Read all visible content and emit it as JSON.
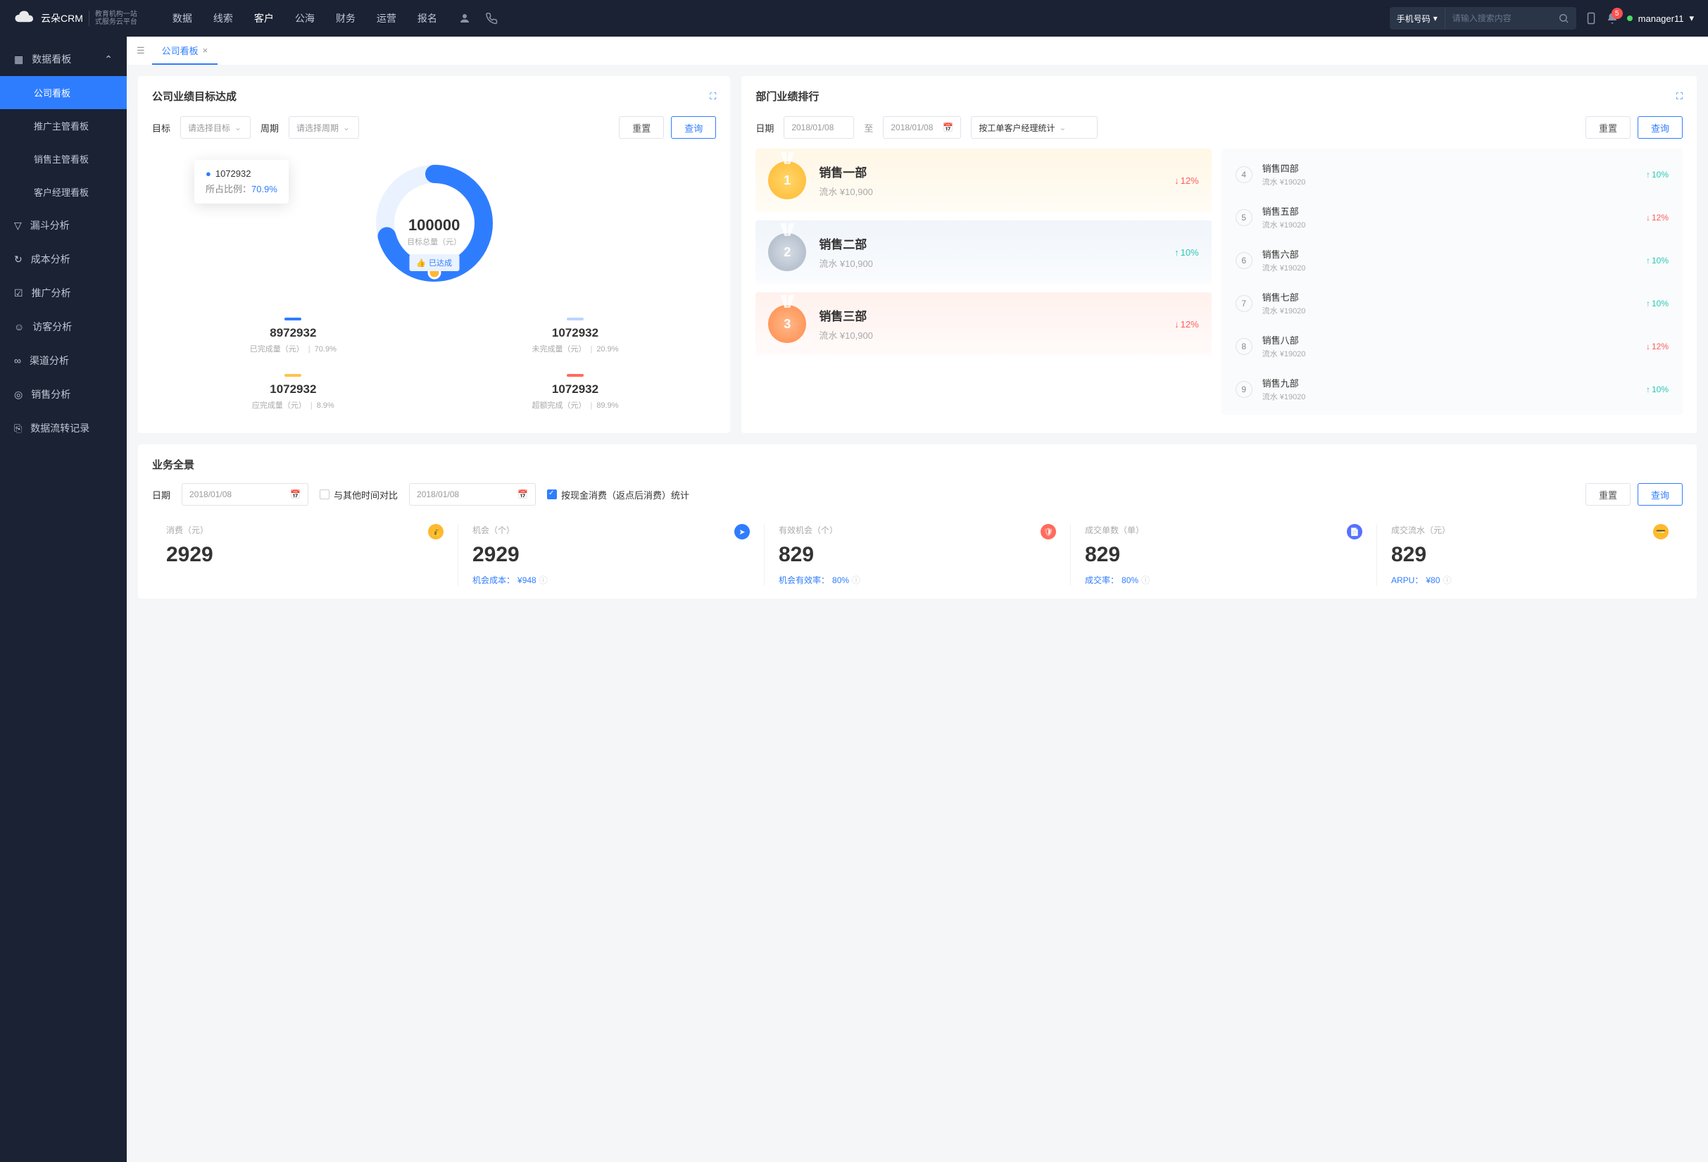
{
  "topbar": {
    "brand": "云朵CRM",
    "brand_sub": "教育机构一站\n式服务云平台",
    "nav": [
      "数据",
      "线索",
      "客户",
      "公海",
      "财务",
      "运营",
      "报名"
    ],
    "nav_active": 2,
    "search_type": "手机号码",
    "search_placeholder": "请输入搜索内容",
    "notif_count": "5",
    "user": "manager11"
  },
  "sidebar": {
    "items": [
      {
        "label": "数据看板",
        "expanded": true,
        "icon": "dashboard"
      },
      {
        "label": "公司看板",
        "sub": true,
        "active": true
      },
      {
        "label": "推广主管看板",
        "sub": true
      },
      {
        "label": "销售主管看板",
        "sub": true
      },
      {
        "label": "客户经理看板",
        "sub": true
      },
      {
        "label": "漏斗分析",
        "icon": "funnel"
      },
      {
        "label": "成本分析",
        "icon": "cost"
      },
      {
        "label": "推广分析",
        "icon": "promo"
      },
      {
        "label": "访客分析",
        "icon": "visitor"
      },
      {
        "label": "渠道分析",
        "icon": "channel"
      },
      {
        "label": "销售分析",
        "icon": "sales"
      },
      {
        "label": "数据流转记录",
        "icon": "flow"
      }
    ]
  },
  "tab": {
    "label": "公司看板"
  },
  "target_card": {
    "title": "公司业绩目标达成",
    "target_label": "目标",
    "target_placeholder": "请选择目标",
    "period_label": "周期",
    "period_placeholder": "请选择周期",
    "reset": "重置",
    "query": "查询",
    "tooltip_value": "1072932",
    "tooltip_ratio_label": "所占比例：",
    "tooltip_ratio": "70.9%",
    "donut_total": "100000",
    "donut_total_label": "目标总量（元）",
    "donut_badge": "已达成",
    "metrics": [
      {
        "color": "#2f7dff",
        "value": "8972932",
        "label": "已完成量（元）",
        "pct": "70.9%"
      },
      {
        "color": "#b9d6ff",
        "value": "1072932",
        "label": "未完成量（元）",
        "pct": "20.9%"
      },
      {
        "color": "#ffc34a",
        "value": "1072932",
        "label": "应完成量（元）",
        "pct": "8.9%"
      },
      {
        "color": "#ff6b5c",
        "value": "1072932",
        "label": "超额完成（元）",
        "pct": "89.9%"
      }
    ]
  },
  "rank_card": {
    "title": "部门业绩排行",
    "date_label": "日期",
    "date_from": "2018/01/08",
    "date_sep": "至",
    "date_to": "2018/01/08",
    "stat_by": "按工单客户经理统计",
    "reset": "重置",
    "query": "查询",
    "top3": [
      {
        "medal": "gold",
        "rank": "1",
        "name": "销售一部",
        "sub": "流水 ¥10,900",
        "change": "12%",
        "dir": "down"
      },
      {
        "medal": "silver",
        "rank": "2",
        "name": "销售二部",
        "sub": "流水 ¥10,900",
        "change": "10%",
        "dir": "up"
      },
      {
        "medal": "bronze",
        "rank": "3",
        "name": "销售三部",
        "sub": "流水 ¥10,900",
        "change": "12%",
        "dir": "down"
      }
    ],
    "rest": [
      {
        "rank": "4",
        "name": "销售四部",
        "sub": "流水 ¥19020",
        "change": "10%",
        "dir": "up"
      },
      {
        "rank": "5",
        "name": "销售五部",
        "sub": "流水 ¥19020",
        "change": "12%",
        "dir": "down"
      },
      {
        "rank": "6",
        "name": "销售六部",
        "sub": "流水 ¥19020",
        "change": "10%",
        "dir": "up"
      },
      {
        "rank": "7",
        "name": "销售七部",
        "sub": "流水 ¥19020",
        "change": "10%",
        "dir": "up"
      },
      {
        "rank": "8",
        "name": "销售八部",
        "sub": "流水 ¥19020",
        "change": "12%",
        "dir": "down"
      },
      {
        "rank": "9",
        "name": "销售九部",
        "sub": "流水 ¥19020",
        "change": "10%",
        "dir": "up"
      }
    ]
  },
  "overview": {
    "title": "业务全景",
    "date_label": "日期",
    "date1": "2018/01/08",
    "compare_label": "与其他时间对比",
    "date2": "2018/01/08",
    "cash_label": "按现金消费（返点后消费）统计",
    "reset": "重置",
    "query": "查询",
    "stats": [
      {
        "label": "消费（元）",
        "value": "2929",
        "icon_color": "#ffb830",
        "icon": "money",
        "sub": null
      },
      {
        "label": "机会（个）",
        "value": "2929",
        "icon_color": "#2f7dff",
        "icon": "send",
        "sub_label": "机会成本：",
        "sub_val": "¥948"
      },
      {
        "label": "有效机会（个）",
        "value": "829",
        "icon_color": "#ff6b5c",
        "icon": "shield",
        "sub_label": "机会有效率：",
        "sub_val": "80%"
      },
      {
        "label": "成交单数（单）",
        "value": "829",
        "icon_color": "#5b6fff",
        "icon": "doc",
        "sub_label": "成交率：",
        "sub_val": "80%"
      },
      {
        "label": "成交流水（元）",
        "value": "829",
        "icon_color": "#ffb830",
        "icon": "card",
        "sub_label": "ARPU：",
        "sub_val": "¥80"
      }
    ]
  },
  "chart_data": {
    "type": "pie",
    "title": "公司业绩目标达成",
    "total_label": "目标总量（元）",
    "total": 100000,
    "series": [
      {
        "name": "已完成量（元）",
        "value": 8972932,
        "pct": 70.9,
        "color": "#2f7dff"
      },
      {
        "name": "未完成量（元）",
        "value": 1072932,
        "pct": 20.9,
        "color": "#b9d6ff"
      },
      {
        "name": "应完成量（元）",
        "value": 1072932,
        "pct": 8.9,
        "color": "#ffc34a"
      },
      {
        "name": "超额完成（元）",
        "value": 1072932,
        "pct": 89.9,
        "color": "#ff6b5c"
      }
    ],
    "highlight": {
      "value": 1072932,
      "pct": 70.9
    }
  }
}
